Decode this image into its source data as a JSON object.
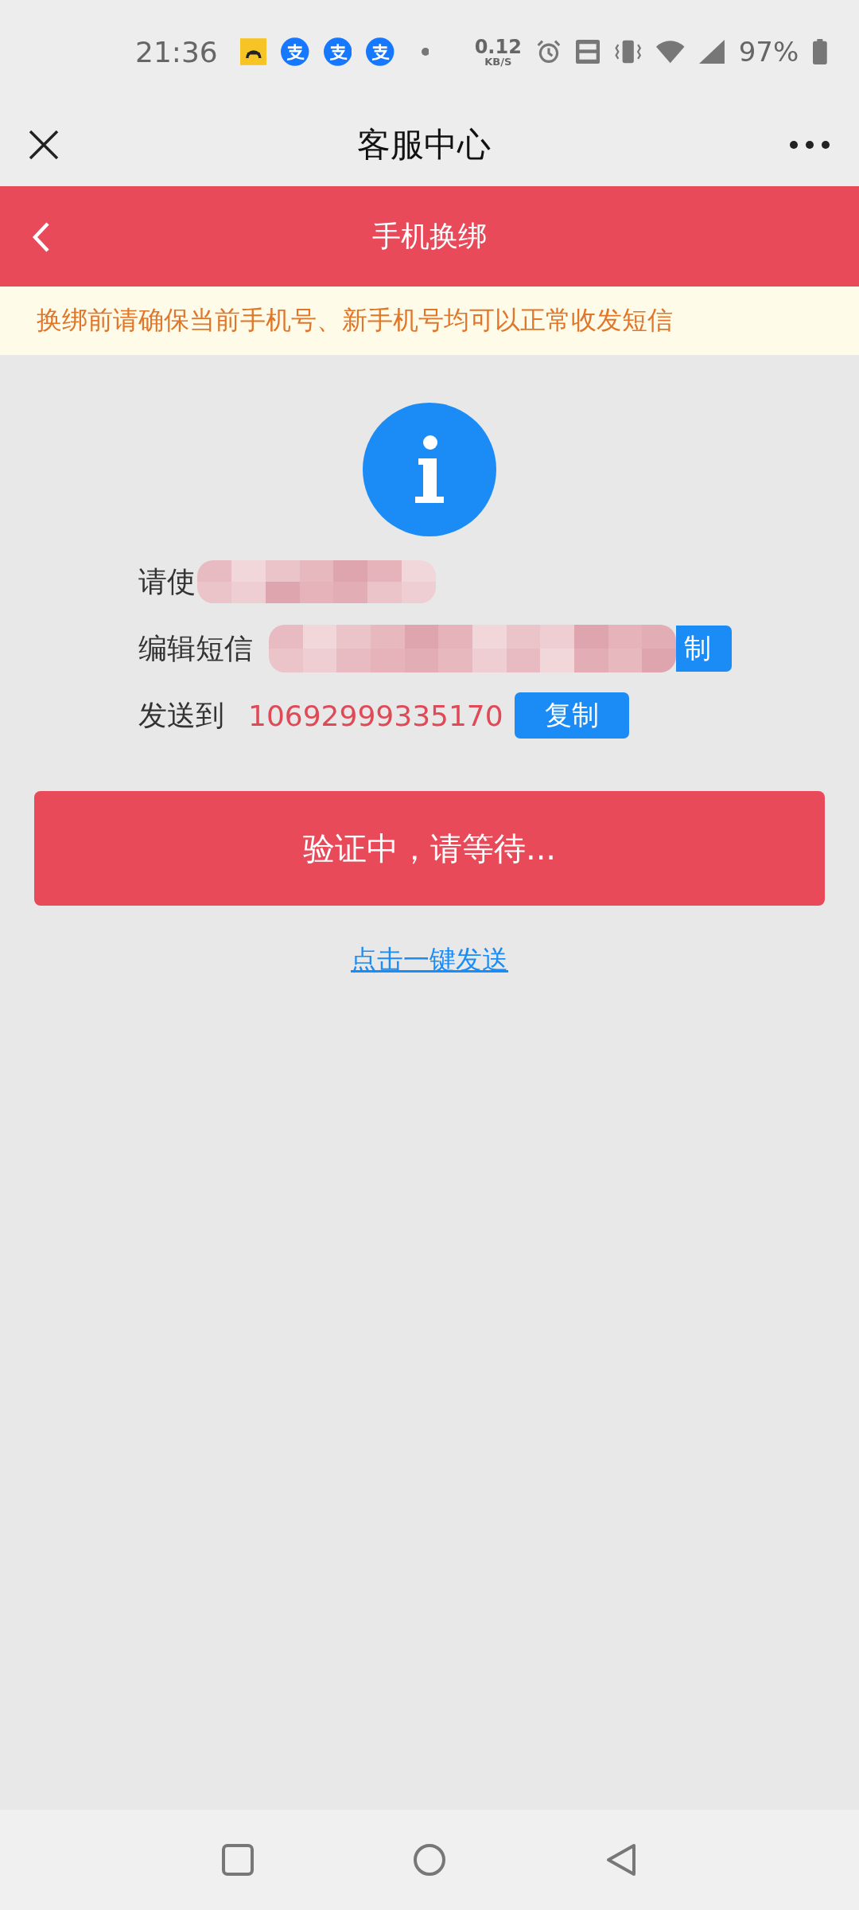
{
  "status_bar": {
    "time": "21:36",
    "net_speed": "0.12",
    "net_unit": "KB/S",
    "battery": "97%"
  },
  "title_bar": {
    "title": "客服中心"
  },
  "header": {
    "title": "手机换绑"
  },
  "notice": "换绑前请确保当前手机号、新手机号均可以正常收发短信",
  "rows": [
    {
      "label": "请使",
      "redacted": true
    },
    {
      "label": "编辑短信",
      "redacted": true,
      "button": "制"
    },
    {
      "label": "发送到",
      "redacted": false,
      "value": "10692999335170",
      "button": "复制"
    }
  ],
  "primary_button": "验证中，请等待...",
  "link": "点击一键发送"
}
